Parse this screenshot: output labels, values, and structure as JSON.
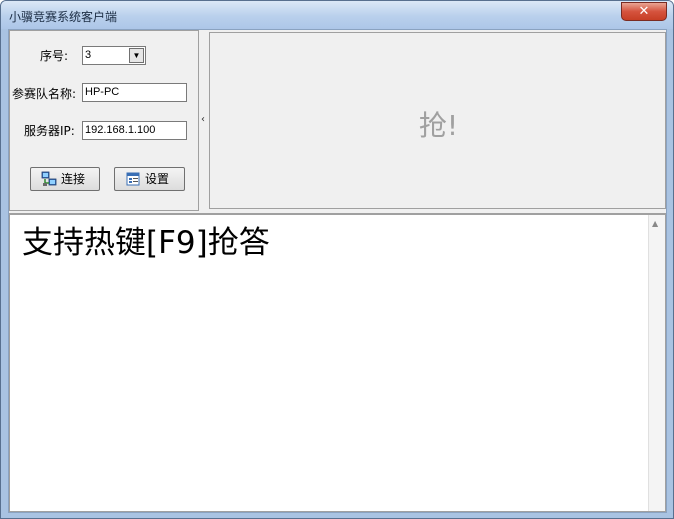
{
  "window": {
    "title": "小骥竞赛系统客户端",
    "close_glyph": "✕"
  },
  "form": {
    "seq_label": "序号:",
    "seq_value": "3",
    "team_label": "参赛队名称:",
    "team_value": "HP-PC",
    "server_label": "服务器IP:",
    "server_value": "192.168.1.100"
  },
  "buttons": {
    "connect": "连接",
    "settings": "设置"
  },
  "splitter": {
    "chevron": "‹"
  },
  "grab": {
    "label": "抢!"
  },
  "content": {
    "message": "支持热键[F9]抢答"
  },
  "scroll": {
    "up": "▲"
  },
  "icons": {
    "connect": "connect-network-icon",
    "settings": "settings-dialog-icon"
  }
}
